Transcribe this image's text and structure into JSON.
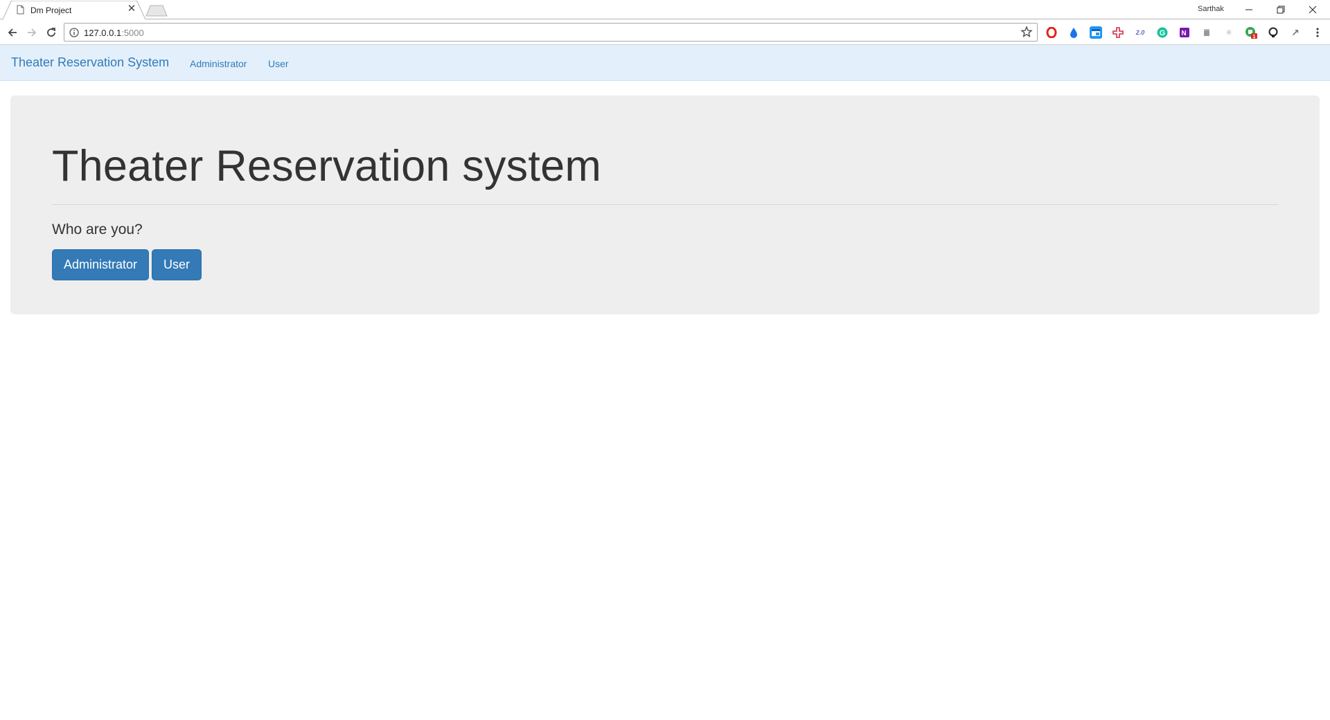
{
  "browser": {
    "tab_title": "Dm Project",
    "profile_name": "Sarthak",
    "url_host": "127.0.0.1",
    "url_port": ":5000",
    "colors": {
      "omnibox_border": "#a9a9a9",
      "tab_border": "#b4b4b4"
    },
    "icons": {
      "back": "arrow-left-icon",
      "forward": "arrow-right-icon",
      "reload": "reload-icon",
      "info": "info-icon",
      "bookmark": "star-icon",
      "menu": "kebab-menu-icon"
    },
    "extensions": [
      {
        "name": "opera-extension-icon",
        "glyph": "O",
        "color": "#e0261b"
      },
      {
        "name": "drop-extension-icon",
        "glyph": "♦",
        "color": "#1a73e8"
      },
      {
        "name": "window-extension-icon",
        "glyph": "▤",
        "color": "#2196f3"
      },
      {
        "name": "cross-extension-icon",
        "glyph": "✚",
        "color": "#d22d3d"
      },
      {
        "name": "web2-extension-icon",
        "glyph": "2.0",
        "color": "#5a6abf"
      },
      {
        "name": "grammarly-icon",
        "glyph": "G",
        "color": "#15c39a"
      },
      {
        "name": "onenote-icon",
        "glyph": "N",
        "color": "#7719aa"
      },
      {
        "name": "mug-extension-icon",
        "glyph": "☕",
        "color": "#999999"
      },
      {
        "name": "spark-extension-icon",
        "glyph": "✳",
        "color": "#bbbbbb"
      },
      {
        "name": "green-badge-extension-icon",
        "glyph": "◉",
        "color": "#34a853"
      },
      {
        "name": "github-icon",
        "glyph": "◯",
        "color": "#222222"
      },
      {
        "name": "arrow-extension-icon",
        "glyph": "↗",
        "color": "#777777"
      }
    ],
    "badge_count": "1"
  },
  "navbar": {
    "brand": "Theater Reservation System",
    "links": [
      "Administrator",
      "User"
    ],
    "colors": {
      "background": "#e3f0fb",
      "link": "#337ab7"
    }
  },
  "jumbotron": {
    "title": "Theater Reservation system",
    "question": "Who are you?",
    "buttons": [
      "Administrator",
      "User"
    ],
    "colors": {
      "background": "#eeeeee",
      "button": "#337ab7"
    }
  }
}
